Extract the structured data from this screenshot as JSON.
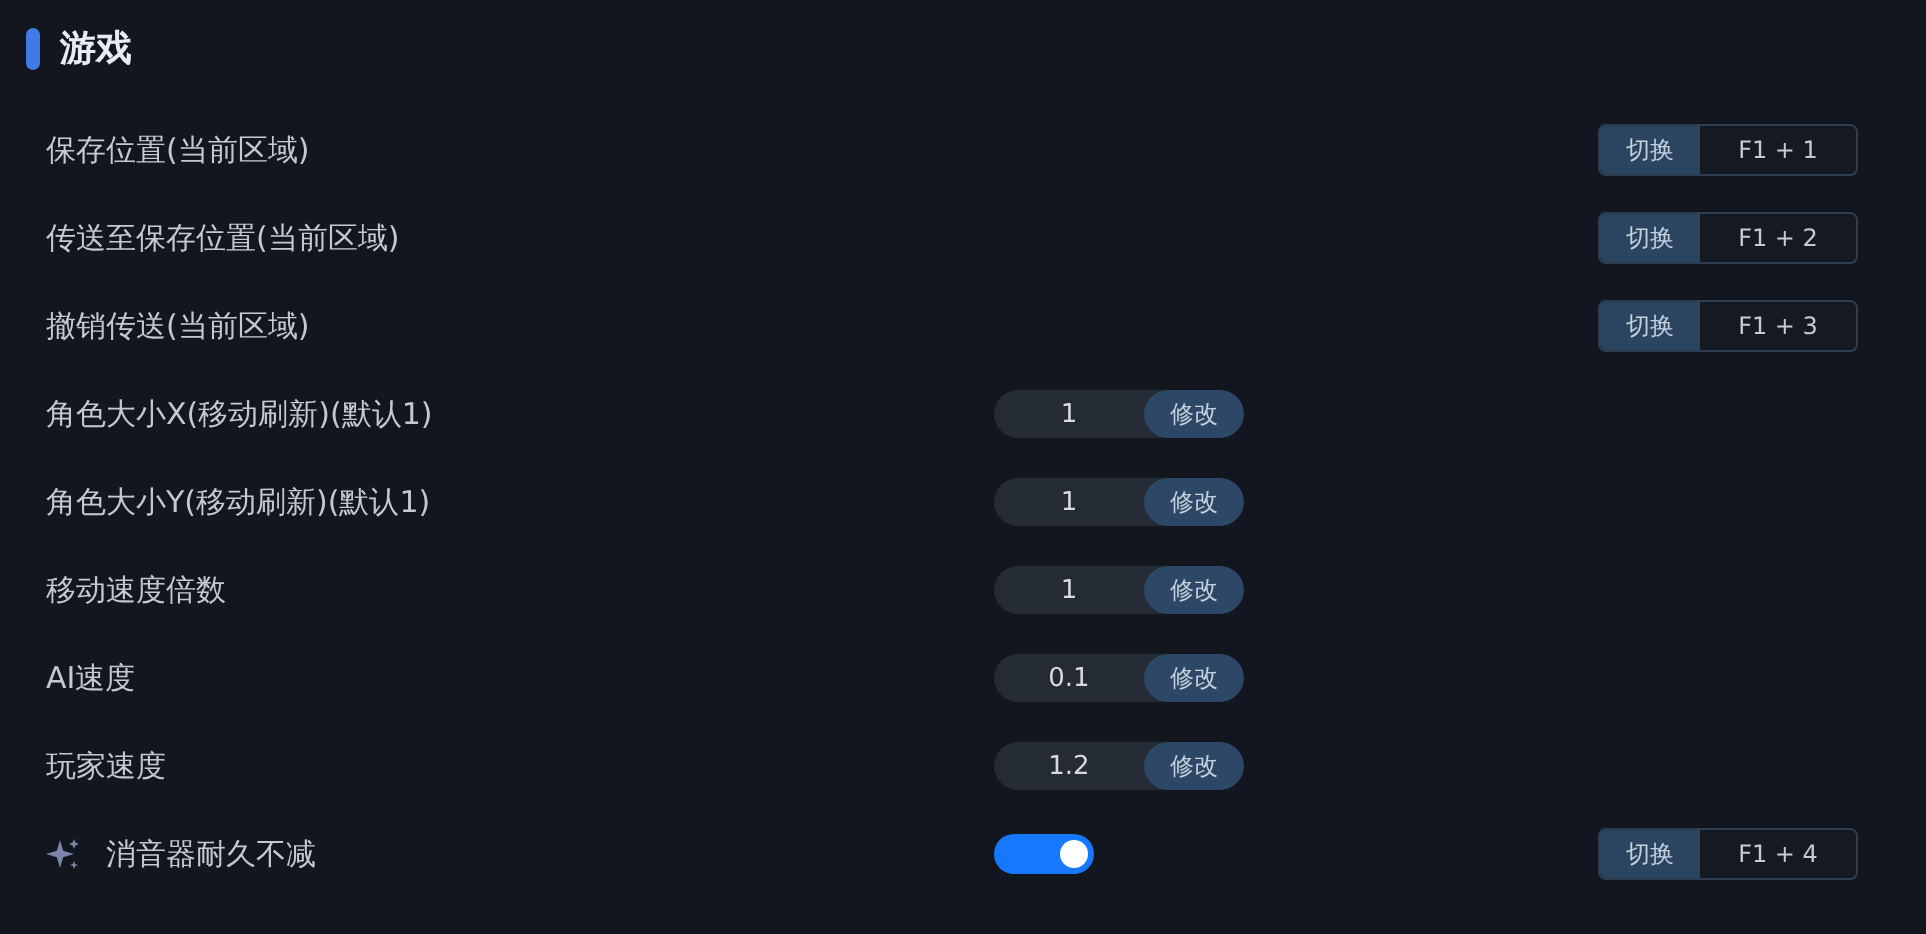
{
  "section": {
    "title": "游戏"
  },
  "rows": [
    {
      "kind": "hotkey",
      "label": "保存位置(当前区域)",
      "action": "切换",
      "key": "F1 + 1"
    },
    {
      "kind": "hotkey",
      "label": "传送至保存位置(当前区域)",
      "action": "切换",
      "key": "F1 + 2"
    },
    {
      "kind": "hotkey",
      "label": "撤销传送(当前区域)",
      "action": "切换",
      "key": "F1 + 3"
    },
    {
      "kind": "number",
      "label": "角色大小X(移动刷新)(默认1)",
      "value": "1",
      "button": "修改"
    },
    {
      "kind": "number",
      "label": "角色大小Y(移动刷新)(默认1)",
      "value": "1",
      "button": "修改"
    },
    {
      "kind": "number",
      "label": "移动速度倍数",
      "value": "1",
      "button": "修改"
    },
    {
      "kind": "number",
      "label": "AI速度",
      "value": "0.1",
      "button": "修改"
    },
    {
      "kind": "number",
      "label": "玩家速度",
      "value": "1.2",
      "button": "修改"
    },
    {
      "kind": "toggle",
      "label": "消音器耐久不减",
      "on": true,
      "action": "切换",
      "key": "F1 + 4"
    }
  ]
}
